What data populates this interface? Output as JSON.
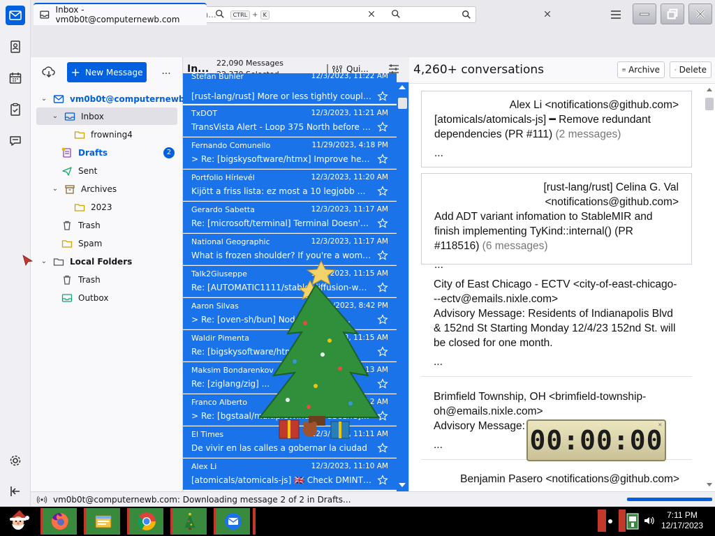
{
  "app": {
    "search_placeholder": "Search...",
    "search_kbd1": "CTRL",
    "search_kbd_plus": "+",
    "search_kbd2": "K"
  },
  "tabs": [
    {
      "label": "Inbox - vm0b0t@computernewb.com"
    },
    {
      "label": ""
    },
    {
      "label": ""
    }
  ],
  "folder_pane": {
    "new_message_label": "New Message",
    "more_label": "...",
    "account": "vm0b0t@computernewb...",
    "folders": [
      {
        "label": "Inbox"
      },
      {
        "label": "frowning4"
      },
      {
        "label": "Drafts",
        "badge": "2"
      },
      {
        "label": "Sent"
      },
      {
        "label": "Archives"
      },
      {
        "label": "2023"
      },
      {
        "label": "Trash"
      },
      {
        "label": "Spam"
      }
    ],
    "local_folders": "Local Folders",
    "local": [
      {
        "label": "Trash"
      },
      {
        "label": "Outbox"
      }
    ]
  },
  "message_list": {
    "folder_short": "In...",
    "count_messages": "22,090 Messages",
    "count_selected": "22,370 Selected",
    "quick_filter": "Qui...",
    "rows": [
      {
        "sender": "Stefan Buhler",
        "date": "12/3/2023, 11:22 AM",
        "subject": "[rust-lang/rust] More or less tightly couple..."
      },
      {
        "sender": "TxDOT",
        "date": "12/3/2023, 11:21 AM",
        "subject": "TransVista Alert - Loop 375 North before S..."
      },
      {
        "sender": "Fernando Comunello",
        "date": "11/29/2023, 4:18 PM",
        "subject": "Re: [bigskysoftware/htmx] Improve head..."
      },
      {
        "sender": "Portfolio Hírlevél",
        "date": "12/3/2023, 11:20 AM",
        "subject": "Kijött a friss lista: ez most a 10 legjobb mu..."
      },
      {
        "sender": "Gerardo Sabetta",
        "date": "12/3/2023, 11:17 AM",
        "subject": "Re: [microsoft/terminal] Terminal Doesn't S..."
      },
      {
        "sender": "National Geographic",
        "date": "12/3/2023, 11:17 AM",
        "subject": "What is frozen shoulder? If you're a woma..."
      },
      {
        "sender": "Talk2Giuseppe",
        "date": "12/3/2023, 11:15 AM",
        "subject": "Re: [AUTOMATIC1111/stable-diffusion-web..."
      },
      {
        "sender": "Aaron Silvas",
        "date": "12/3/2023, 8:42 PM",
        "subject": "Re: [oven-sh/bun] Node 18 ... ing ..."
      },
      {
        "sender": "Waldir Pimenta",
        "date": "12/3/2023, 11:15 AM",
        "subject": "Re: [bigskysoftware/htmx] ..."
      },
      {
        "sender": "Maksim Bondarenkov",
        "date": "12/3/2023, 11:13 AM",
        "subject": "Re: [ziglang/zig] ..."
      },
      {
        "sender": "Franco Alberto",
        "date": "12/3/2023, 11:12 AM",
        "subject": "Re: [bgstaal/multipleWindow3dScene] H..."
      },
      {
        "sender": "El Times",
        "date": "12/3/2023, 11:11 AM",
        "subject": "De vivir en las calles a gobernar la ciudad"
      },
      {
        "sender": "Alex Li",
        "date": "12/3/2023, 11:10 AM",
        "subject": "[atomicals/atomicals-js] 🇬🇧 Check DMINT it..."
      }
    ]
  },
  "reading_pane": {
    "conversations": "4,260+ conversations",
    "archive_label": "Archive",
    "delete_label": "Delete",
    "cards": [
      {
        "from": "Alex Li <notifications@github.com>",
        "subject": "[atomicals/atomicals-js] ━ Remove redundant dependencies (PR #111)",
        "count": "(2 messages)",
        "ellipsis": "..."
      },
      {
        "from": "[rust-lang/rust] Celina G. Val <notifications@github.com>",
        "subject": "Add ADT variant infomation to StableMIR and finish implementing TyKind::internal() (PR #118516)",
        "count": "(6 messages)",
        "ellipsis": "..."
      },
      {
        "from": "City of East Chicago - ECTV <city-of-east-chicago---ectv@emails.nixle.com>",
        "subject": "Advisory Message: Residents of Indianapolis Blvd & 152nd St Starting Monday 12/4/23 152nd St. will be closed for one month.",
        "count": "",
        "ellipsis": "..."
      },
      {
        "from": "Brimfield Township, OH <brimfield-township-oh@emails.nixle.com>",
        "subject": "Advisory Message:",
        "count": "",
        "ellipsis": "..."
      },
      {
        "from": "Benjamin Pasero <notifications@github.com>",
        "subject": "",
        "count": "",
        "ellipsis": ""
      }
    ]
  },
  "status": {
    "text": "vm0b0t@computernewb.com: Downloading message 2 of 2 in Drafts..."
  },
  "timer_widget": {
    "display": "00:00:00"
  },
  "taskbar": {
    "time": "7:11 PM",
    "date": "12/17/2023"
  },
  "colors": {
    "accent": "#0060df",
    "selection": "#1a73e8",
    "badge": "#0060df"
  }
}
